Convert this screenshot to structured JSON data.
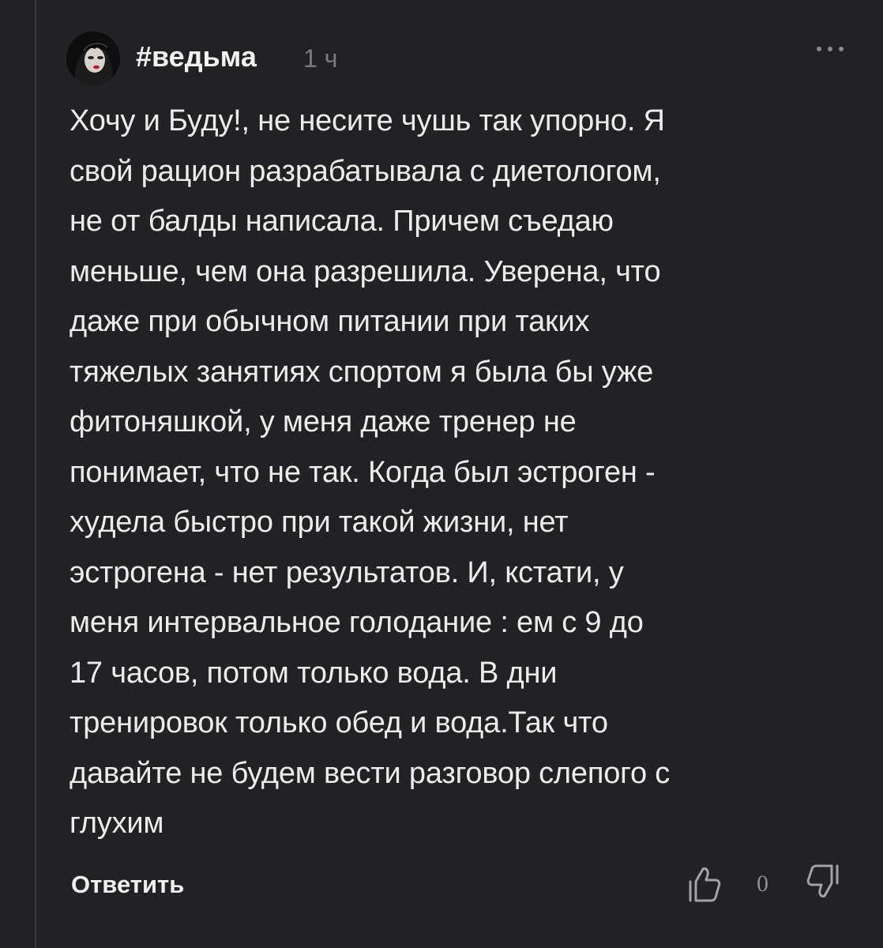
{
  "comment": {
    "author": "#ведьма",
    "time": "1 ч",
    "more_icon": "more-dots-icon",
    "avatar_icon": "user-avatar",
    "lines": [
      "Хочу и Буду!, не несите чушь так упорно. Я",
      "свой рацион разрабатывала с диетологом,",
      "не от балды написала. Причем съедаю",
      "меньше, чем она разрешила. Уверена, что",
      "даже при обычном питании при таких",
      "тяжелых занятиях спортом я была бы уже",
      "фитоняшкой, у меня даже тренер не",
      "понимает, что не так. Когда был эстроген -",
      "худела быстро при такой жизни, нет",
      "эстрогена - нет результатов. И, кстати, у",
      "меня интервальное голодание : ем с 9 до",
      "17 часов, потом только вода. В дни",
      "тренировок только обед и вода.Так что",
      "давайте не будем вести разговор слепого с",
      "глухим"
    ],
    "reply_label": "Ответить",
    "like_icon": "thumbs-up-icon",
    "dislike_icon": "thumbs-down-icon",
    "vote_count": "0"
  },
  "colors": {
    "background": "#222123",
    "text": "#ececec",
    "muted": "#7b7a7d",
    "thread_line": "#3a393b"
  }
}
